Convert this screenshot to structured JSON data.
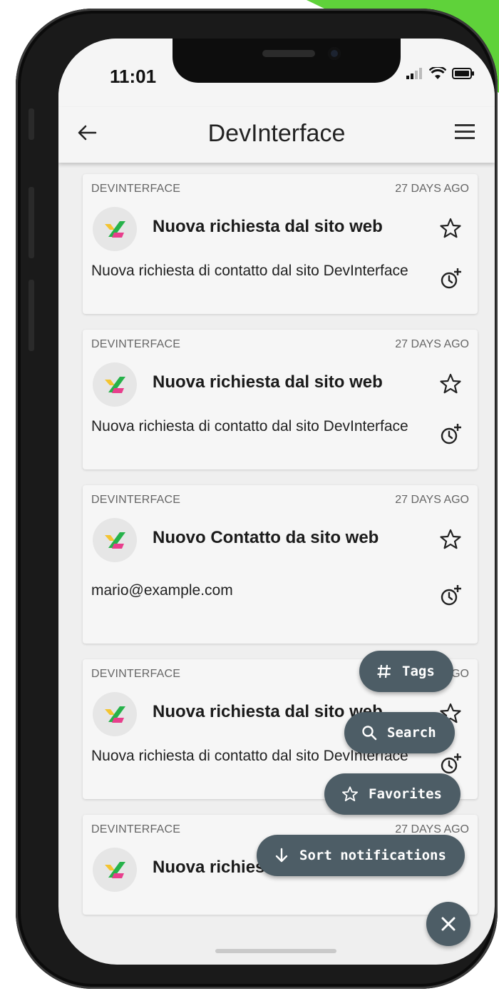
{
  "status_bar": {
    "time": "11:01"
  },
  "app_bar": {
    "title": "DevInterface"
  },
  "notifications": [
    {
      "source": "DEVINTERFACE",
      "age": "27 DAYS AGO",
      "title": "Nuova richiesta dal sito web",
      "body": "Nuova richiesta di contatto dal sito DevInterface"
    },
    {
      "source": "DEVINTERFACE",
      "age": "27 DAYS AGO",
      "title": "Nuova richiesta dal sito web",
      "body": "Nuova richiesta di contatto dal sito DevInterface"
    },
    {
      "source": "DEVINTERFACE",
      "age": "27 DAYS AGO",
      "title": "Nuovo Contatto da sito web",
      "body": "mario@example.com"
    },
    {
      "source": "DEVINTERFACE",
      "age": "27 DAYS AGO",
      "title": "Nuova richiesta dal sito web",
      "body": "Nuova richiesta di contatto dal sito DevInterface"
    },
    {
      "source": "DEVINTERFACE",
      "age": "27 DAYS AGO",
      "title": "Nuova richiesta dal sito web",
      "body": ""
    }
  ],
  "fab_menu": {
    "tags": "Tags",
    "search": "Search",
    "favorites": "Favorites",
    "sort": "Sort notifications"
  },
  "icons": {
    "back": "arrow-left-icon",
    "menu": "hamburger-menu-icon",
    "favorite": "star-outline-icon",
    "snooze": "snooze-clock-icon",
    "close": "close-icon"
  },
  "colors": {
    "fab": "#4d5d66",
    "accent_green": "#5fd23a",
    "card": "#f6f6f6"
  }
}
